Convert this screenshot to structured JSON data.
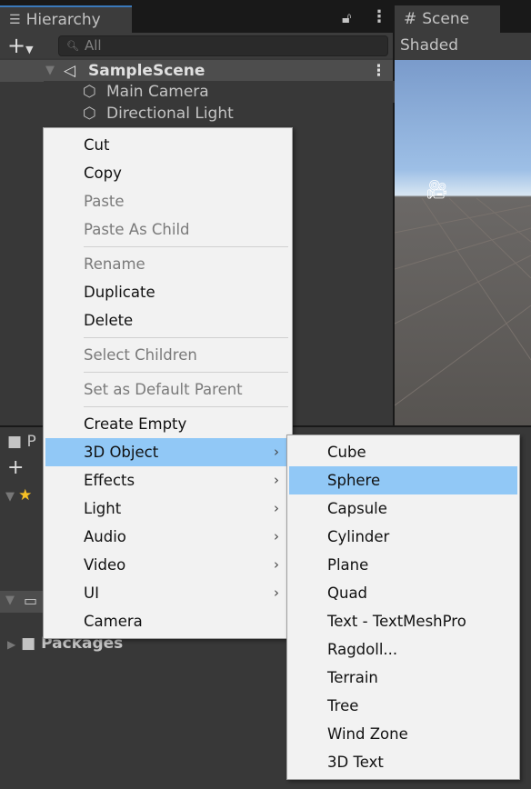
{
  "hierarchy": {
    "tab": "Hierarchy",
    "search_placeholder": "All",
    "scene": "SampleScene",
    "items": [
      "Main Camera",
      "Directional Light"
    ]
  },
  "scene": {
    "tab": "Scene",
    "shading": "Shaded"
  },
  "project": {
    "tab": "P",
    "packages": "Packages"
  },
  "context_menu": {
    "groups": [
      [
        {
          "label": "Cut"
        },
        {
          "label": "Copy"
        },
        {
          "label": "Paste",
          "disabled": true
        },
        {
          "label": "Paste As Child",
          "disabled": true
        }
      ],
      [
        {
          "label": "Rename",
          "disabled": true
        },
        {
          "label": "Duplicate"
        },
        {
          "label": "Delete"
        }
      ],
      [
        {
          "label": "Select Children",
          "disabled": true
        }
      ],
      [
        {
          "label": "Set as Default Parent",
          "disabled": true
        }
      ],
      [
        {
          "label": "Create Empty"
        },
        {
          "label": "3D Object",
          "submenu": true,
          "highlighted": true
        },
        {
          "label": "Effects",
          "submenu": true
        },
        {
          "label": "Light",
          "submenu": true
        },
        {
          "label": "Audio",
          "submenu": true
        },
        {
          "label": "Video",
          "submenu": true
        },
        {
          "label": "UI",
          "submenu": true
        },
        {
          "label": "Camera"
        }
      ]
    ]
  },
  "submenu": {
    "items": [
      "Cube",
      "Sphere",
      "Capsule",
      "Cylinder",
      "Plane",
      "Quad",
      "Text - TextMeshPro",
      "Ragdoll...",
      "Terrain",
      "Tree",
      "Wind Zone",
      "3D Text"
    ],
    "highlighted": "Sphere"
  },
  "colors": {
    "highlight": "#91c8f6",
    "accent": "#3a79bb"
  }
}
